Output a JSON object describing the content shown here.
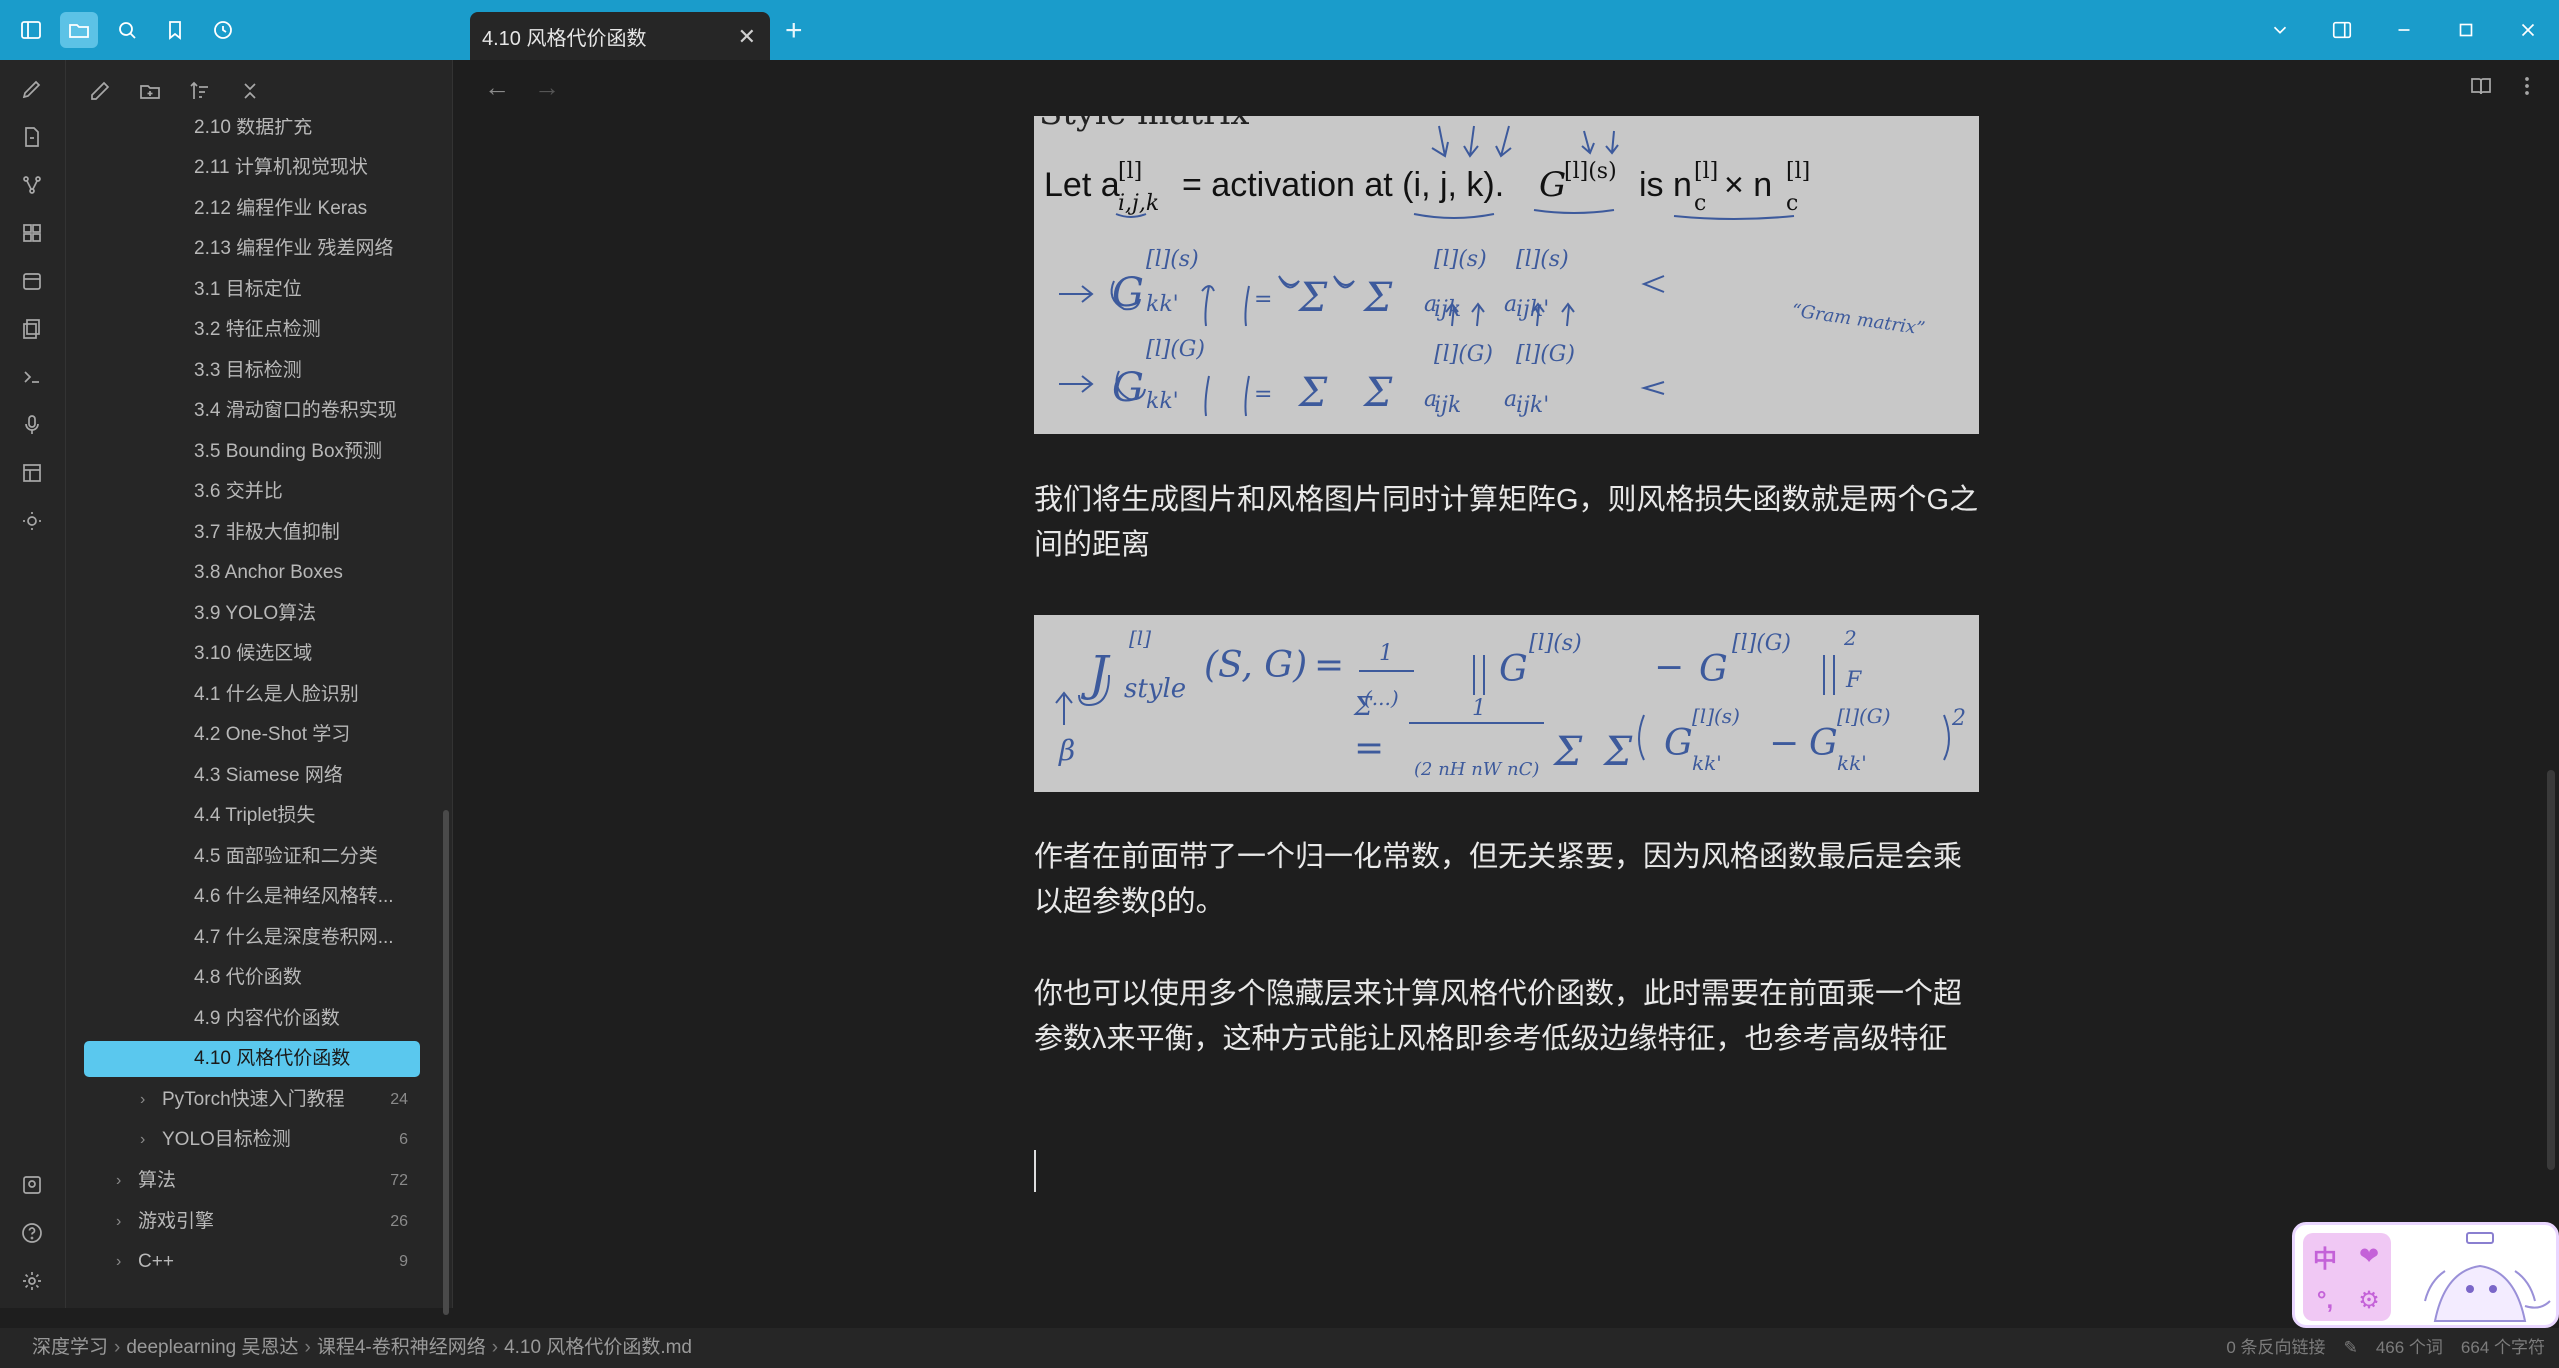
{
  "titlebar": {
    "tab_title": "4.10 风格代价函数",
    "close_glyph": "✕",
    "new_tab_glyph": "+"
  },
  "sidebar": {
    "items": [
      {
        "label": "2.10 数据扩充",
        "level": 2
      },
      {
        "label": "2.11 计算机视觉现状",
        "level": 2
      },
      {
        "label": "2.12 编程作业 Keras",
        "level": 2
      },
      {
        "label": "2.13 编程作业 残差网络",
        "level": 2
      },
      {
        "label": "3.1 目标定位",
        "level": 2
      },
      {
        "label": "3.2 特征点检测",
        "level": 2
      },
      {
        "label": "3.3 目标检测",
        "level": 2
      },
      {
        "label": "3.4 滑动窗口的卷积实现",
        "level": 2
      },
      {
        "label": "3.5 Bounding Box预测",
        "level": 2
      },
      {
        "label": "3.6 交并比",
        "level": 2
      },
      {
        "label": "3.7 非极大值抑制",
        "level": 2
      },
      {
        "label": "3.8 Anchor Boxes",
        "level": 2
      },
      {
        "label": "3.9 YOLO算法",
        "level": 2
      },
      {
        "label": "3.10 候选区域",
        "level": 2
      },
      {
        "label": "4.1 什么是人脸识别",
        "level": 2
      },
      {
        "label": "4.2 One-Shot 学习",
        "level": 2
      },
      {
        "label": "4.3 Siamese 网络",
        "level": 2
      },
      {
        "label": "4.4 Triplet损失",
        "level": 2
      },
      {
        "label": "4.5 面部验证和二分类",
        "level": 2
      },
      {
        "label": "4.6 什么是神经风格转...",
        "level": 2
      },
      {
        "label": "4.7 什么是深度卷积网...",
        "level": 2
      },
      {
        "label": "4.8 代价函数",
        "level": 2
      },
      {
        "label": "4.9 内容代价函数",
        "level": 2
      },
      {
        "label": "4.10 风格代价函数",
        "level": 2,
        "active": true
      }
    ],
    "folders": [
      {
        "label": "PyTorch快速入门教程",
        "count": "24",
        "level": 1
      },
      {
        "label": "YOLO目标检测",
        "count": "6",
        "level": 1
      },
      {
        "label": "算法",
        "count": "72",
        "level": 0
      },
      {
        "label": "游戏引擎",
        "count": "26",
        "level": 0
      },
      {
        "label": "C++",
        "count": "9",
        "level": 0
      }
    ]
  },
  "editor": {
    "image1": {
      "partial_heading": "Style matrix",
      "let_text": "Let a",
      "activation_text": "= activation at (i, j, k).",
      "g_text": "G",
      "sup_text": "[l](s)",
      "is_text": "is n",
      "times_text": "× n",
      "sub_c": "c",
      "sub_ijk": "i,j,k",
      "sup_l": "[l]",
      "gram_text": "“Gram matrix”"
    },
    "paragraph1": "我们将生成图片和风格图片同时计算矩阵G，则风格损失函数就是两个G之间的距离",
    "paragraph2": "作者在前面带了一个归一化常数，但无关紧要，因为风格函数最后是会乘以超参数β的。",
    "paragraph3": "你也可以使用多个隐藏层来计算风格代价函数，此时需要在前面乘一个超参数λ来平衡，这种方式能让风格即参考低级边缘特征，也参考高级特征"
  },
  "statusbar": {
    "breadcrumb": [
      "深度学习",
      "deeplearning 吴恩达",
      "课程4-卷积神经网络",
      "4.10 风格代价函数.md"
    ],
    "backlinks": "0 条反向链接",
    "words": "466 个词",
    "chars": "664 个字符"
  },
  "pet": {
    "keys": [
      "中",
      "❤",
      "°,",
      "⚙"
    ]
  },
  "colors": {
    "titlebar": "#1a9ccb",
    "active_item": "#5ac8ee",
    "background": "#1e1e1e",
    "sidebar": "#262626"
  }
}
